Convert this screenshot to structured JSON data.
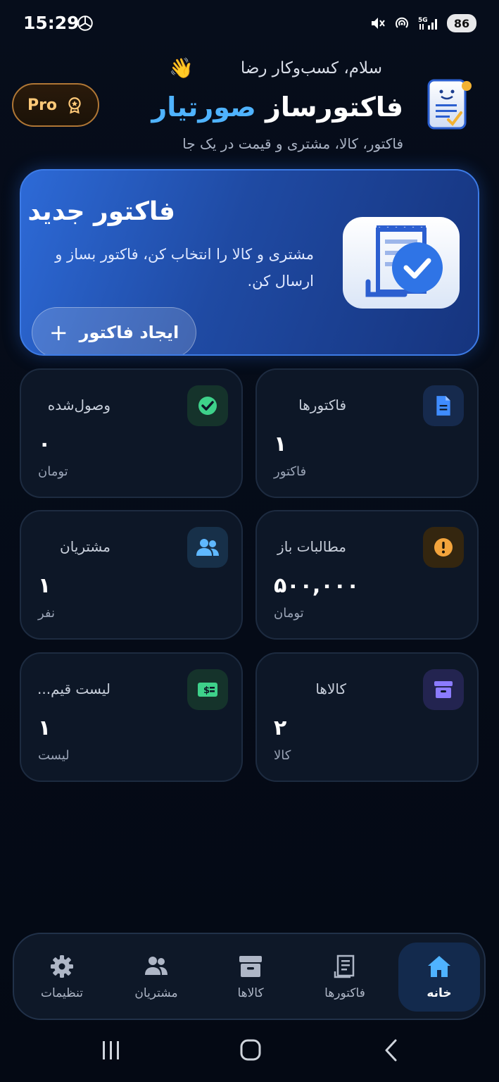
{
  "status_bar": {
    "time": "15:29",
    "battery": "86",
    "icons": [
      "openai-icon",
      "mute-icon",
      "hotspot-icon",
      "5g-signal-icon"
    ]
  },
  "header": {
    "greeting": "سلام، کسب‌وکار رضا",
    "greeting_emoji": "👋",
    "title_part1": "فاکتورساز",
    "title_part2": "صورتیار",
    "subtitle": "فاکتور، کالا، مشتری و قیمت در یک جا",
    "pro_label": "Pro"
  },
  "hero": {
    "title": "فاکتور جدید",
    "description": "مشتری و کالا را انتخاب کن، فاکتور بساز و ارسال کن.",
    "button_label": "ایجاد فاکتور",
    "button_icon": "+"
  },
  "stats": [
    {
      "title": "فاکتورها",
      "value": "۱",
      "unit": "فاکتور",
      "icon": "document-icon",
      "color": "#3f8cff"
    },
    {
      "title": "وصول‌شده",
      "value": "۰",
      "unit": "تومان",
      "icon": "check-circle-icon",
      "color": "#3ed18a"
    },
    {
      "title": "مطالبات باز",
      "value": "۵۰۰,۰۰۰",
      "unit": "تومان",
      "icon": "alert-circle-icon",
      "color": "#f3a43c"
    },
    {
      "title": "مشتریان",
      "value": "۱",
      "unit": "نفر",
      "icon": "users-icon",
      "color": "#5fb8ff"
    },
    {
      "title": "کالاها",
      "value": "۲",
      "unit": "کالا",
      "icon": "archive-icon",
      "color": "#8b7bff"
    },
    {
      "title": "لیست قیم...",
      "value": "۱",
      "unit": "لیست",
      "icon": "money-icon",
      "color": "#3ed18a"
    }
  ],
  "bottom_nav": [
    {
      "label": "خانه",
      "icon": "home-icon",
      "active": true
    },
    {
      "label": "فاکتورها",
      "icon": "receipt-icon",
      "active": false
    },
    {
      "label": "کالاها",
      "icon": "archive-icon",
      "active": false
    },
    {
      "label": "مشتریان",
      "icon": "users-icon",
      "active": false
    },
    {
      "label": "تنظیمات",
      "icon": "gear-icon",
      "active": false
    }
  ],
  "colors": {
    "background": "#050b16",
    "accent": "#4fb3ff",
    "hero": "#2d6ad7",
    "card": "#0d1727",
    "pro": "#ffc978"
  }
}
